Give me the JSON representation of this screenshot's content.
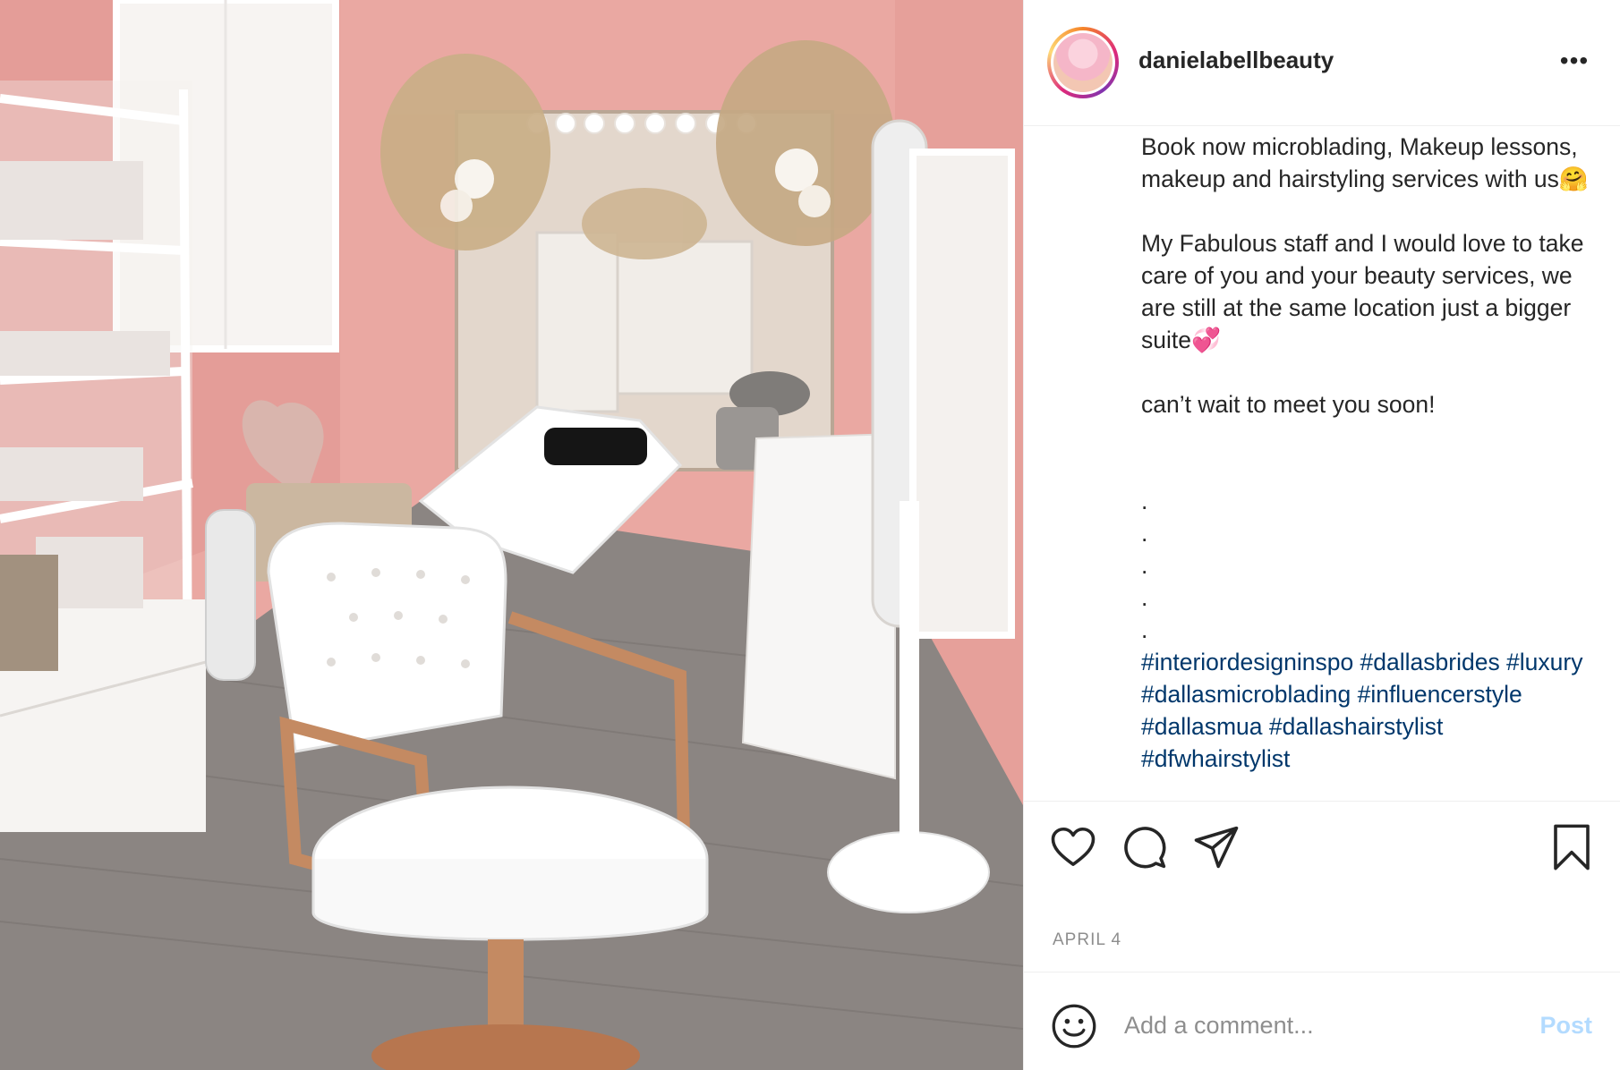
{
  "post": {
    "username": "danielabellbeauty",
    "more_label": "•••",
    "caption_paragraphs": [
      "Book now microblading, Makeup lessons, makeup and hairstyling services with us🤗",
      "My Fabulous staff and I would love to take care of you and your beauty services, we are still at the same location just a bigger suite💞",
      "can’t wait to meet you soon!"
    ],
    "caption_dots": [
      ".",
      ".",
      ".",
      ".",
      "."
    ],
    "hashtags": "#interiordesigninspo #dallasbrides #luxury #dallasmicroblading #influencerstyle #dallasmua #dallashairstylist #dfwhairstylist",
    "date": "APRIL 4"
  },
  "actions": {
    "icons": [
      "heart-icon",
      "comment-icon",
      "share-icon",
      "bookmark-icon"
    ]
  },
  "comment": {
    "placeholder": "Add a comment...",
    "post_label": "Post"
  },
  "colors": {
    "wall_pink": "#e9a9a3",
    "hashtag_blue": "#00376b",
    "post_disabled": "#b3dbff",
    "text": "#262626",
    "muted": "#8e8e8e"
  }
}
